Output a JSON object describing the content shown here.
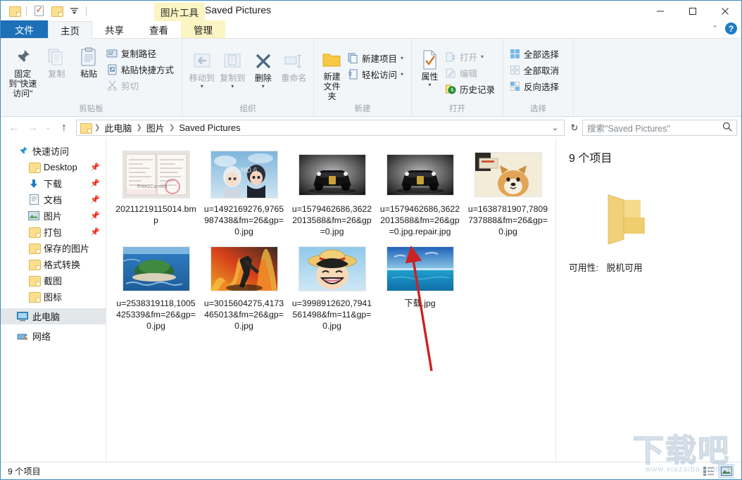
{
  "window": {
    "title": "Saved Pictures",
    "contextual_tab_group": "图片工具",
    "minimize": "—",
    "maximize": "☐",
    "close": "✕"
  },
  "quick_access_toolbar": {
    "items": [
      {
        "name": "properties-folder-icon",
        "label": ""
      },
      {
        "name": "new-folder-check-icon",
        "label": ""
      },
      {
        "name": "folder-icon",
        "label": ""
      },
      {
        "name": "customize-chevron",
        "label": "▾"
      }
    ]
  },
  "tabs": [
    {
      "id": "file",
      "label": "文件",
      "state": "file-menu"
    },
    {
      "id": "home",
      "label": "主页",
      "state": "active"
    },
    {
      "id": "share",
      "label": "共享",
      "state": "normal"
    },
    {
      "id": "view",
      "label": "查看",
      "state": "normal"
    },
    {
      "id": "manage",
      "label": "管理",
      "state": "contextual"
    }
  ],
  "ribbon": {
    "collapse_caret": "⌃",
    "help_label": "?",
    "groups": [
      {
        "name": "clipboard",
        "label": "剪贴板",
        "big_buttons": [
          {
            "name": "pin-to-quick-access-button",
            "label": "固定到\"快速访问\"",
            "icon": "pin-icon",
            "disabled": false
          },
          {
            "name": "copy-button",
            "label": "复制",
            "icon": "copy-icon",
            "disabled": true
          },
          {
            "name": "paste-button",
            "label": "粘贴",
            "icon": "paste-icon",
            "disabled": false
          }
        ],
        "small_buttons": [
          {
            "name": "copy-path-button",
            "label": "复制路径",
            "icon": "copy-path-icon",
            "disabled": false
          },
          {
            "name": "paste-shortcut-button",
            "label": "粘贴快捷方式",
            "icon": "paste-shortcut-icon",
            "disabled": false
          },
          {
            "name": "cut-button",
            "label": "剪切",
            "icon": "scissors-icon",
            "disabled": true
          }
        ]
      },
      {
        "name": "organize",
        "label": "组织",
        "big_buttons": [
          {
            "name": "move-to-button",
            "label": "移动到",
            "icon": "move-to-icon",
            "disabled": true,
            "dropdown": true
          },
          {
            "name": "copy-to-button",
            "label": "复制到",
            "icon": "copy-to-icon",
            "disabled": true,
            "dropdown": true
          },
          {
            "name": "delete-button",
            "label": "删除",
            "icon": "delete-x-icon",
            "disabled": false,
            "dropdown": true
          },
          {
            "name": "rename-button",
            "label": "重命名",
            "icon": "rename-icon",
            "disabled": true
          }
        ],
        "small_buttons": []
      },
      {
        "name": "new",
        "label": "新建",
        "big_buttons": [
          {
            "name": "new-folder-button",
            "label": "新建\n文件夹",
            "icon": "new-folder-icon",
            "disabled": false
          }
        ],
        "small_buttons": [
          {
            "name": "new-item-button",
            "label": "新建项目",
            "icon": "new-item-icon",
            "dropdown": true,
            "disabled": false
          },
          {
            "name": "easy-access-button",
            "label": "轻松访问",
            "icon": "easy-access-icon",
            "dropdown": true,
            "disabled": false
          }
        ]
      },
      {
        "name": "open",
        "label": "打开",
        "big_buttons": [
          {
            "name": "properties-button",
            "label": "属性",
            "icon": "properties-icon",
            "disabled": false,
            "dropdown": true
          }
        ],
        "small_buttons": [
          {
            "name": "open-button",
            "label": "打开",
            "icon": "open-icon",
            "dropdown": true,
            "disabled": true
          },
          {
            "name": "edit-button",
            "label": "编辑",
            "icon": "edit-icon",
            "disabled": true
          },
          {
            "name": "history-button",
            "label": "历史记录",
            "icon": "history-icon",
            "disabled": false
          }
        ]
      },
      {
        "name": "select",
        "label": "选择",
        "big_buttons": [],
        "small_buttons": [
          {
            "name": "select-all-button",
            "label": "全部选择",
            "icon": "select-all-icon",
            "disabled": false
          },
          {
            "name": "select-none-button",
            "label": "全部取消",
            "icon": "select-none-icon",
            "disabled": false
          },
          {
            "name": "invert-selection-button",
            "label": "反向选择",
            "icon": "invert-selection-icon",
            "disabled": false
          }
        ]
      }
    ]
  },
  "address_bar": {
    "back": "←",
    "forward": "→",
    "recent_chevron": "⌄",
    "up": "↑",
    "breadcrumbs": [
      "此电脑",
      "图片",
      "Saved Pictures"
    ],
    "dropdown": "⌄",
    "refresh": "↻",
    "search_placeholder": "搜索\"Saved Pictures\""
  },
  "sidebar": {
    "items": [
      {
        "label": "快速访问",
        "icon": "star-pin-icon",
        "level": 0,
        "pinned": false,
        "selected": false
      },
      {
        "label": "Desktop",
        "icon": "folder-icon",
        "level": 1,
        "pinned": true,
        "selected": false
      },
      {
        "label": "下载",
        "icon": "download-arrow-icon",
        "level": 1,
        "pinned": true,
        "selected": false
      },
      {
        "label": "文档",
        "icon": "documents-icon",
        "level": 1,
        "pinned": true,
        "selected": false
      },
      {
        "label": "图片",
        "icon": "pictures-icon",
        "level": 1,
        "pinned": true,
        "selected": false
      },
      {
        "label": "打包",
        "icon": "folder-icon",
        "level": 1,
        "pinned": true,
        "selected": false
      },
      {
        "label": "保存的图片",
        "icon": "folder-icon",
        "level": 1,
        "pinned": false,
        "selected": false
      },
      {
        "label": "格式转换",
        "icon": "folder-icon",
        "level": 1,
        "pinned": false,
        "selected": false
      },
      {
        "label": "截图",
        "icon": "folder-icon",
        "level": 1,
        "pinned": false,
        "selected": false
      },
      {
        "label": "图标",
        "icon": "folder-icon",
        "level": 1,
        "pinned": false,
        "selected": false
      },
      {
        "label": "此电脑",
        "icon": "this-pc-icon",
        "level": 0,
        "pinned": false,
        "selected": true
      },
      {
        "label": "网络",
        "icon": "network-icon",
        "level": 0,
        "pinned": false,
        "selected": false
      }
    ]
  },
  "files": [
    {
      "name": "20211219115014.bmp",
      "thumb": "passport-document"
    },
    {
      "name": "u=1492169276,9765987438&fm=26&gp=0.jpg",
      "thumb": "anime-no6"
    },
    {
      "name": "u=1579462686,36222013588&fm=26&gp=0.jpg",
      "thumb": "black-sportscar"
    },
    {
      "name": "u=1579462686,36222013588&fm=26&gp=0.jpg.repair.jpg",
      "thumb": "black-sportscar"
    },
    {
      "name": "u=1638781907,7809737888&fm=26&gp=0.jpg",
      "thumb": "shiba-doge"
    },
    {
      "name": "u=2538319118,1005425339&fm=26&gp=0.jpg",
      "thumb": "island-sea"
    },
    {
      "name": "u=3015604275,4173465013&fm=26&gp=0.jpg",
      "thumb": "fire-warrior"
    },
    {
      "name": "u=3998912620,7941561498&fm=11&gp=0.jpg",
      "thumb": "luffy-anime"
    },
    {
      "name": "下载.jpg",
      "thumb": "blue-ocean"
    }
  ],
  "details_pane": {
    "title": "9 个项目",
    "icon": "folder-large-icon",
    "property_label": "可用性:",
    "property_value": "脱机可用"
  },
  "status_bar": {
    "item_count": "9 个项目",
    "views": [
      {
        "name": "details-view-button",
        "active": false
      },
      {
        "name": "large-icons-view-button",
        "active": true
      }
    ]
  },
  "watermark": {
    "text": "下载吧",
    "subtext": "www.xiazaiba.com"
  },
  "colors": {
    "accent_blue": "#1d6fb8",
    "contextual_yellow": "#fbf4c3",
    "ribbon_bg": "#f3f6f9",
    "selection_gray": "#e4e7ea",
    "annotation_red": "#cc2222"
  }
}
